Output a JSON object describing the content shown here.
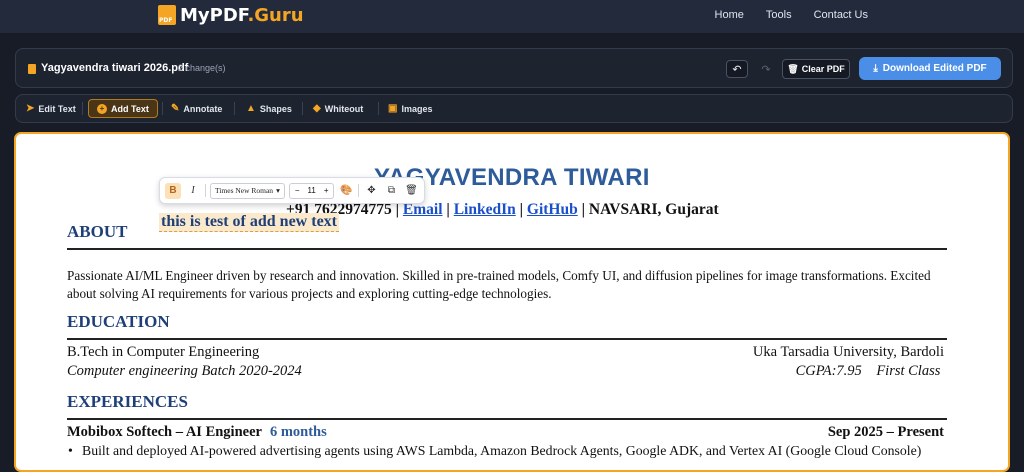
{
  "nav": {
    "logo_pdf": "PDF",
    "logo_main": "MyPDF",
    "logo_accent": ".Guru",
    "links": [
      "Home",
      "Tools",
      "Contact Us"
    ]
  },
  "filebar": {
    "file_name": "Yagyavendra tiwari 2026.pdf",
    "changes": "2 change(s)",
    "undo_icon": "↶",
    "redo_icon": "↷",
    "clear_label": "Clear PDF",
    "download_label": "Download Edited PDF"
  },
  "toolbar": {
    "tools": [
      {
        "label": "Edit Text",
        "icon": "cursor-icon"
      },
      {
        "label": "Add Text",
        "icon": "plus-circle-icon",
        "active": true
      },
      {
        "label": "Annotate",
        "icon": "pen-icon"
      },
      {
        "label": "Shapes",
        "icon": "shapes-icon"
      },
      {
        "label": "Whiteout",
        "icon": "eraser-icon"
      },
      {
        "label": "Images",
        "icon": "image-icon"
      }
    ]
  },
  "format_bar": {
    "bold": "B",
    "italic": "I",
    "font": "Times New Roman",
    "size_minus": "−",
    "size": "11",
    "size_plus": "+"
  },
  "doc": {
    "name_title": "YAGYAVENDRA TIWARI",
    "phone": "+91 7622974775",
    "email": "Email",
    "linkedin": "LinkedIn",
    "github": "GitHub",
    "location": "NAVSARI, Gujarat",
    "new_text": "this is test of add new text",
    "about_heading": "ABOUT",
    "about_text": "Passionate AI/ML Engineer driven by research and innovation. Skilled in pre-trained models, Comfy UI, and diffusion pipelines for image transformations. Excited about solving AI requirements for various projects and exploring cutting-edge technologies.",
    "education_heading": "EDUCATION",
    "degree": "B.Tech in Computer Engineering",
    "university": "Uka Tarsadia University, Bardoli",
    "batch": "Computer engineering Batch 2020-2024",
    "cgpa": "CGPA:7.95",
    "class": "First Class",
    "experiences_heading": "EXPERIENCES",
    "job_title": "Mobibox Softech – AI Engineer",
    "job_duration": "6 months",
    "job_dates": "Sep 2025 – Present",
    "bullet_1": "Built and deployed AI-powered advertising agents using AWS Lambda, Amazon Bedrock Agents, Google ADK, and Vertex AI (Google Cloud Console)"
  }
}
